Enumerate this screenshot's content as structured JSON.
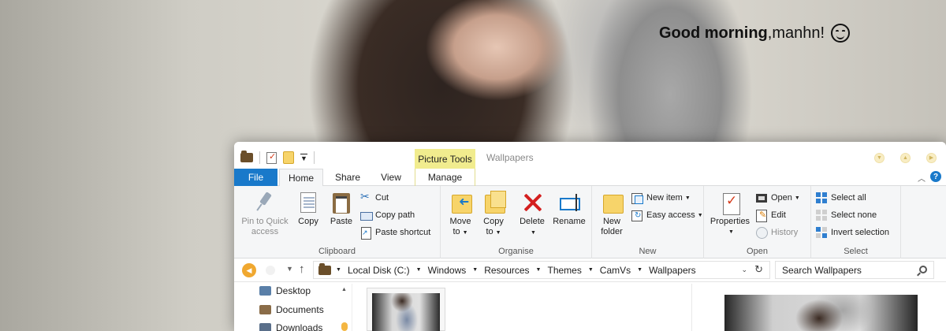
{
  "desktop": {
    "greeting_bold": "Good morning",
    "greeting_rest": ",manhn!",
    "greeting_icon": "smiling-face-icon"
  },
  "window": {
    "title": "Wallpapers",
    "contextual_tab_group": "Picture Tools",
    "tabs": [
      {
        "label": "File"
      },
      {
        "label": "Home"
      },
      {
        "label": "Share"
      },
      {
        "label": "View"
      },
      {
        "label": "Manage"
      }
    ],
    "help_label": "?"
  },
  "ribbon": {
    "clipboard": {
      "label": "Clipboard",
      "pin": "Pin to Quick access",
      "pin_line1": "Pin to Quick",
      "pin_line2": "access",
      "copy": "Copy",
      "paste": "Paste",
      "cut": "Cut",
      "copy_path": "Copy path",
      "paste_shortcut": "Paste shortcut"
    },
    "organise": {
      "label": "Organise",
      "move_to_line1": "Move",
      "move_to_line2": "to",
      "copy_to_line1": "Copy",
      "copy_to_line2": "to",
      "delete": "Delete",
      "rename": "Rename"
    },
    "new": {
      "label": "New",
      "new_folder_line1": "New",
      "new_folder_line2": "folder",
      "new_item": "New item",
      "easy_access": "Easy access"
    },
    "open": {
      "label": "Open",
      "properties": "Properties",
      "open": "Open",
      "edit": "Edit",
      "history": "History"
    },
    "select": {
      "label": "Select",
      "select_all": "Select all",
      "select_none": "Select none",
      "invert_selection": "Invert selection"
    }
  },
  "address_bar": {
    "breadcrumbs": [
      "Local Disk (C:)",
      "Windows",
      "Resources",
      "Themes",
      "CamVs",
      "Wallpapers"
    ],
    "search_placeholder": "Search Wallpapers"
  },
  "nav_pane": {
    "items": [
      {
        "label": "Desktop"
      },
      {
        "label": "Documents"
      },
      {
        "label": "Downloads"
      }
    ]
  },
  "colors": {
    "accent": "#1979ca",
    "contextual_tab": "#f1ec8e",
    "delete_red": "#d41f1f"
  }
}
